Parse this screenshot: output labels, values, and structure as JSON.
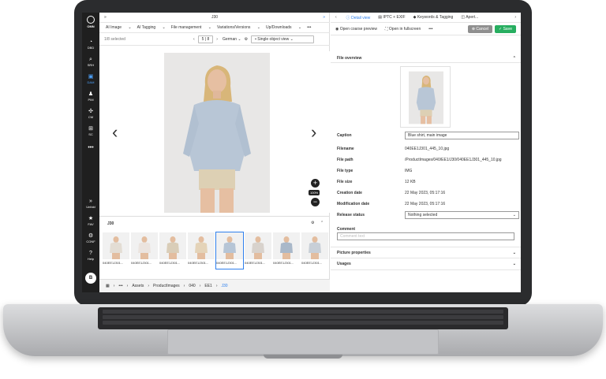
{
  "sidebar": {
    "brand": "OMN",
    "items": [
      {
        "label": "DBD",
        "icon": "dashboard-icon"
      },
      {
        "label": "SRH",
        "icon": "search-icon"
      },
      {
        "label": "DAM",
        "icon": "folder-icon"
      },
      {
        "label": "PIM",
        "icon": "person-icon"
      },
      {
        "label": "CM",
        "icon": "network-icon"
      },
      {
        "label": "SC",
        "icon": "cart-icon"
      },
      {
        "label": "",
        "icon": "more-icon"
      }
    ],
    "bottom": [
      {
        "label": "Unfold",
        "icon": "double-chevron-icon"
      },
      {
        "label": "FAV",
        "icon": "star-icon"
      },
      {
        "label": "CONF",
        "icon": "gear-icon"
      },
      {
        "label": "Help",
        "icon": "help-icon"
      }
    ],
    "avatar": "B"
  },
  "left": {
    "title": "J30",
    "menu": [
      "AI Image",
      "AI Tagging",
      "File management",
      "Variations/Versions",
      "Up/Downloads",
      "•••"
    ],
    "selected": "1/8 selected",
    "page": "5 | 8",
    "language": "German",
    "view": "Single object view",
    "zoom": "100%",
    "strip_title": "J30",
    "thumbs": [
      "040EE1J301...",
      "040EE1J301...",
      "040EE1J301...",
      "040EE1J301...",
      "040EE1J301...",
      "040EE1J301...",
      "040EE1J301...",
      "040EE1J301..."
    ],
    "breadcrumb": [
      "Assets",
      "ProductImages",
      "040",
      "EE1",
      "J30"
    ]
  },
  "right": {
    "tabs": [
      "Detail view",
      "IPTC + EXIF",
      "Keywords & Tagging",
      "Apert..."
    ],
    "toolbar": {
      "coarse": "Open coarse preview",
      "fullscreen": "Open in fullscreen",
      "more": "•••",
      "cancel": "Cancel",
      "save": "Save"
    },
    "file_overview": "File overview",
    "caption_label": "Caption",
    "caption_value": "Blue shirt, main image",
    "fields": [
      {
        "label": "Filename",
        "value": "040EE1J301_445_10.jpg"
      },
      {
        "label": "File path",
        "value": "/ProductImages/040/EE1/J30/040EE1J301_445_10.jpg"
      },
      {
        "label": "File type",
        "value": "IMG"
      },
      {
        "label": "File size",
        "value": "12 KB"
      },
      {
        "label": "Creation date",
        "value": "22 May 2023, 05:17:16"
      },
      {
        "label": "Modification date",
        "value": "22 May 2023, 05:17:16"
      }
    ],
    "release_label": "Release status",
    "release_value": "Nothing selected",
    "comment_label": "Comment",
    "comment_placeholder": "Comment text",
    "picture_properties": "Picture properties",
    "usages": "Usages"
  }
}
